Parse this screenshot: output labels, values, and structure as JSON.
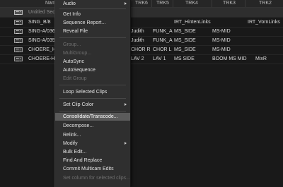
{
  "table": {
    "headers": {
      "name": "Nam",
      "trk6": "TRK6",
      "trk5": "TRK5",
      "trk4": "TRK4",
      "trk3": "TRK3",
      "trk2": "TRK2"
    },
    "rows": [
      {
        "name": "Untitled Seq",
        "c1": "",
        "c2": "",
        "c3": "",
        "c4": "",
        "c5": "",
        "c6": ""
      },
      {
        "name": "SING_B/8",
        "c1": "",
        "c2": "",
        "c3": "",
        "c4": "IRT_HintenLinks",
        "c5": "",
        "c6": "IRT_VornLinks"
      },
      {
        "name": "SING-A/036",
        "c1": "Judith",
        "c2": "FUNK_A",
        "c3": "MS_SIDE",
        "c4": "MS-MID",
        "c5": "",
        "c6": ""
      },
      {
        "name": "SING-A/035",
        "c1": "Judith",
        "c2": "FUNK_A",
        "c3": "MS_SIDE",
        "c4": "MS-MID",
        "c5": "",
        "c6": ""
      },
      {
        "name": "CHOERE_H_",
        "c1": "CHOR  R",
        "c2": "CHOR  L",
        "c3": "MS_SIDE",
        "c4": "MS-MID",
        "c5": "",
        "c6": ""
      },
      {
        "name": "CHOERE-H/",
        "c1": "LAV 2",
        "c2": "LAV 1",
        "c3": "MS SIDE",
        "c4": "BOOM MS MID",
        "c5": "MixR",
        "c6": ""
      }
    ]
  },
  "menu": {
    "items": [
      {
        "label": "Audio",
        "submenu": true,
        "disabled": false
      },
      {
        "label": "Get Info",
        "submenu": false,
        "disabled": false
      },
      {
        "label": "Sequence Report...",
        "submenu": false,
        "disabled": false
      },
      {
        "label": "Reveal File",
        "submenu": false,
        "disabled": false
      },
      {
        "label": "Group...",
        "submenu": false,
        "disabled": true
      },
      {
        "label": "MultiGroup...",
        "submenu": false,
        "disabled": true
      },
      {
        "label": "AutoSync",
        "submenu": false,
        "disabled": false
      },
      {
        "label": "AutoSequence",
        "submenu": false,
        "disabled": false
      },
      {
        "label": "Edit Group",
        "submenu": false,
        "disabled": true
      },
      {
        "label": "Loop Selected Clips",
        "submenu": false,
        "disabled": false
      },
      {
        "label": "Set Clip Color",
        "submenu": true,
        "disabled": false
      },
      {
        "label": "Consolidate/Transcode...",
        "submenu": false,
        "disabled": false,
        "highlighted": true
      },
      {
        "label": "Decompose...",
        "submenu": false,
        "disabled": false
      },
      {
        "label": "Relink...",
        "submenu": false,
        "disabled": false
      },
      {
        "label": "Modify",
        "submenu": true,
        "disabled": false
      },
      {
        "label": "Bulk Edit...",
        "submenu": false,
        "disabled": false
      },
      {
        "label": "Find And Replace",
        "submenu": false,
        "disabled": false
      },
      {
        "label": "Commit Multicam Edits",
        "submenu": false,
        "disabled": false
      },
      {
        "label": "Set column for selected clips...",
        "submenu": false,
        "disabled": true
      }
    ]
  },
  "colors": {
    "background": "#191919",
    "menu_background": "#2f2f2f",
    "menu_highlight": "#5b5b5b",
    "disabled_text": "#6e6e6e"
  }
}
